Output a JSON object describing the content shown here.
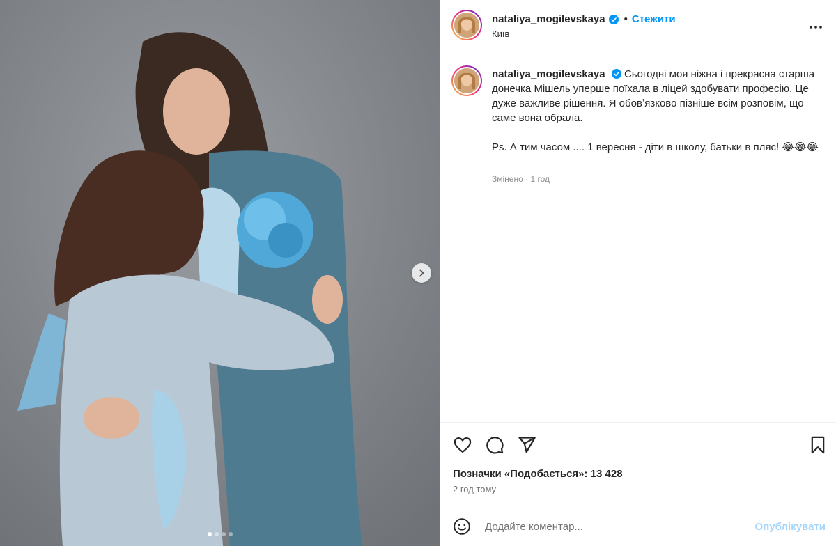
{
  "post": {
    "username": "nataliya_mogilevskaya",
    "location": "Київ",
    "follow_label": "Стежити",
    "separator": "•",
    "caption": {
      "line1": "Сьогодні моя ніжна і прекрасна старша донечка Мішель уперше поїхала в ліцей здобувати професію. Це дуже важливе рішення. Я обовʼязково пізніше всім розповім, що саме вона обрала.",
      "line2": "Ps. А тим часом .... 1 вересня - діти в школу, батьки в пляс! 😂😂😂",
      "edited": "Змінено",
      "meta_sep": "·",
      "age": "1 год"
    },
    "likes_text": "Позначки «Подобається»: 13 428",
    "time_ago": "2 год тому",
    "comment": {
      "placeholder": "Додайте коментар...",
      "publish_label": "Опублікувати"
    },
    "carousel": {
      "total": 4,
      "current": 1
    }
  },
  "icons": {
    "verified": "verified-badge-icon",
    "more": "more-options-icon",
    "like": "heart-icon",
    "comment": "comment-icon",
    "share": "share-icon",
    "save": "bookmark-icon",
    "emoji": "emoji-icon",
    "next": "chevron-right-icon"
  },
  "colors": {
    "accent": "#0095f6",
    "publish_disabled": "#a5d5fb",
    "verified": "#0095f6",
    "muted": "#737373"
  }
}
